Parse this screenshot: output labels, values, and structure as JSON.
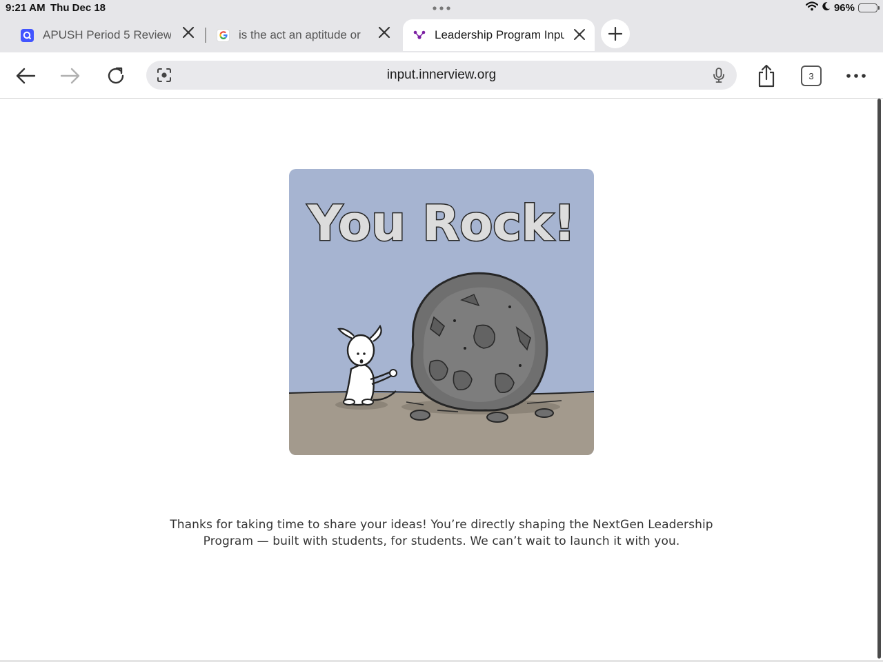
{
  "status_bar": {
    "time": "9:21 AM",
    "date": "Thu Dec 18",
    "battery_percent": "96%",
    "battery_level": 0.96,
    "battery_color": "#f3c010"
  },
  "tabs": [
    {
      "title": "APUSH Period 5 Review",
      "favicon": "quizlet-icon",
      "favicon_color": "#4255ff",
      "active": false
    },
    {
      "title": "is the act an aptitude or",
      "favicon": "google-icon",
      "active": false
    },
    {
      "title": "Leadership Program Inpu",
      "favicon": "innerview-icon",
      "favicon_color": "#7b1fa2",
      "active": true
    }
  ],
  "toolbar": {
    "url": "input.innerview.org",
    "tab_count": "3"
  },
  "hero_image": {
    "heading": "You Rock!",
    "sky_color": "#a6b4d1",
    "ground_color": "#a39a8d"
  },
  "message": "Thanks for taking  time to share your ideas! You’re directly shaping the NextGen Leadership Program — built with students, for students. We can’t wait to launch it with you."
}
